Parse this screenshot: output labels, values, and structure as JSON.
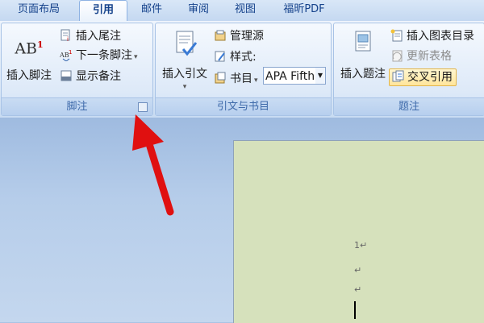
{
  "tabs": [
    "页面布局",
    "引用",
    "邮件",
    "审阅",
    "视图",
    "福昕PDF"
  ],
  "active_tab": "引用",
  "groups": {
    "footnotes": {
      "label": "脚注",
      "insert_footnote": "插入脚注",
      "insert_endnote": "插入尾注",
      "next_footnote": "下一条脚注",
      "show_notes": "显示备注",
      "ab_icon": "AB",
      "ab_sup": "1"
    },
    "citations": {
      "label": "引文与书目",
      "insert_citation": "插入引文",
      "manage_sources": "管理源",
      "style_label": "样式:",
      "style_value": "APA Fifth",
      "bibliography": "书目"
    },
    "captions": {
      "label": "题注",
      "insert_caption": "插入题注",
      "insert_table_of_figures": "插入图表目录",
      "update_table": "更新表格",
      "cross_reference": "交叉引用"
    }
  },
  "document": {
    "line1": "1↵",
    "line2": "↵",
    "line3": "↵"
  },
  "colors": {
    "annotation_arrow": "#e01010",
    "page_background": "#d6e1bc",
    "ribbon_text": "#15428b"
  }
}
